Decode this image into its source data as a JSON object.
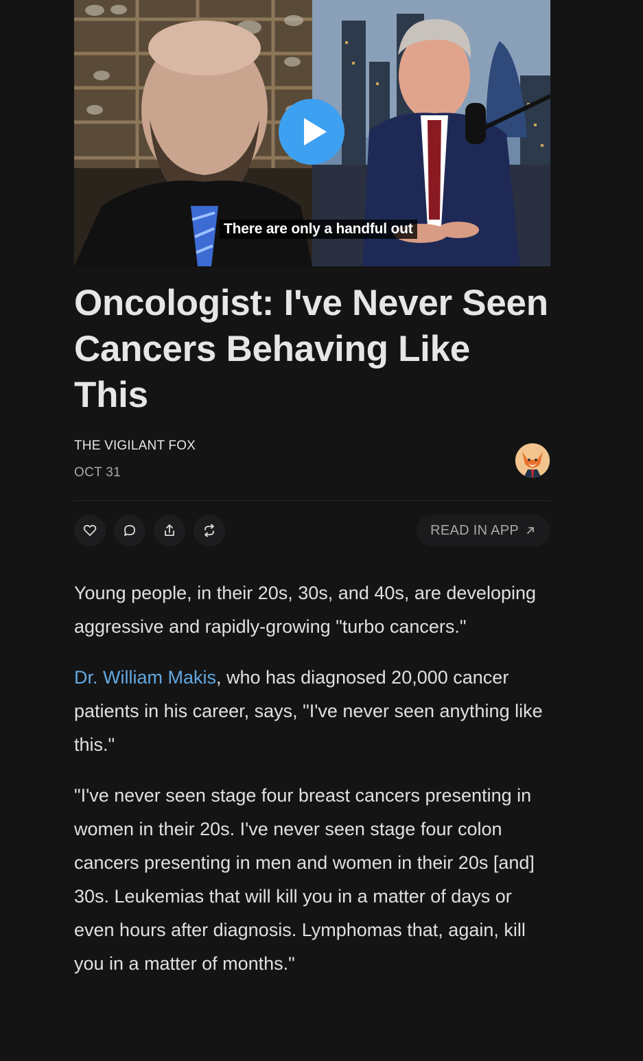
{
  "video": {
    "caption": "There are only a handful out"
  },
  "post": {
    "title": "Oncologist: I've Never Seen Cancers Behaving Like This",
    "author": "THE VIGILANT FOX",
    "date": "OCT 31"
  },
  "actions": {
    "read_in_app": "READ IN APP",
    "read_in_app_icon": "arrow-up-right-icon",
    "icons": [
      "heart-icon",
      "comment-icon",
      "share-icon",
      "restack-icon"
    ]
  },
  "body": {
    "p1": "Young people, in their 20s, 30s, and 40s, are developing aggressive and rapidly-growing \"turbo cancers.\"",
    "p2_link": "Dr. William Makis",
    "p2_rest": ", who has diagnosed 20,000 cancer patients in his career, says, \"I've never seen anything like this.\"",
    "p3": "\"I've never seen stage four breast cancers presenting in women in their 20s. I've never seen stage four colon cancers presenting in men and women in their 20s [and] 30s. Leukemias that will kill you in a matter of days or even hours after diagnosis. Lymphomas that, again, kill you in a matter of months.\""
  },
  "colors": {
    "background": "#141415",
    "link": "#62a8e0",
    "play_button": "#3ea0f0"
  }
}
